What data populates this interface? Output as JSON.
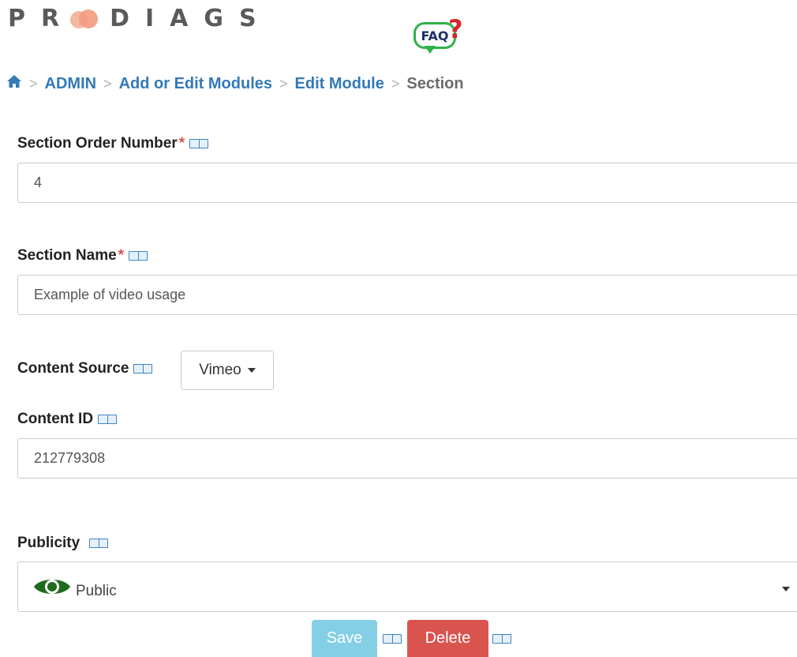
{
  "logo": {
    "text_left": "PR",
    "text_right": "DIAGS"
  },
  "faq": {
    "label": "FAQ",
    "mark": "?"
  },
  "breadcrumb": {
    "home_icon": "home-icon",
    "sep": ">",
    "items": [
      "ADMIN",
      "Add or Edit Modules",
      "Edit Module"
    ],
    "current": "Section"
  },
  "form": {
    "order_label": "Section Order Number",
    "order_value": "4",
    "name_label": "Section Name",
    "name_value": "Example of video usage",
    "required_mark": "*",
    "source_label": "Content Source",
    "source_value": "Vimeo",
    "content_id_label": "Content ID",
    "content_id_value": "212779308",
    "publicity_label": "Publicity",
    "publicity_value": "Public",
    "publicity_icon": "eye-icon",
    "translate_icon": "translate-icon"
  },
  "actions": {
    "save_label": "Save",
    "delete_label": "Delete"
  },
  "colors": {
    "link": "#337ab7",
    "required": "#d9534f",
    "save": "#5bc0de",
    "delete": "#d9534f",
    "eye": "#1f6b1f"
  }
}
